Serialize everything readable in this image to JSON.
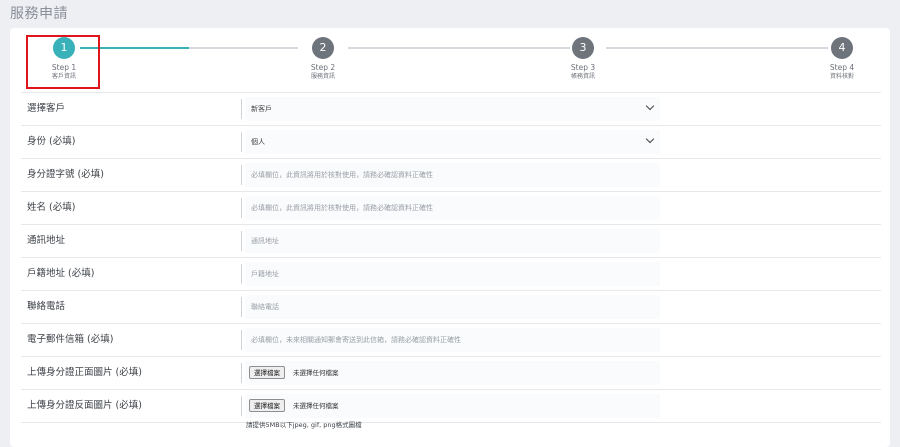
{
  "page_title": "服務申請",
  "stepper": {
    "steps": [
      {
        "number": "1",
        "label": "Step 1",
        "sub": "客戶資訊",
        "active": true
      },
      {
        "number": "2",
        "label": "Step 2",
        "sub": "服務資訊",
        "active": false
      },
      {
        "number": "3",
        "label": "Step 3",
        "sub": "帳務資訊",
        "active": false
      },
      {
        "number": "4",
        "label": "Step 4",
        "sub": "資料核對",
        "active": false
      }
    ],
    "progress_first_segment": 0.5,
    "colors": {
      "active": "#38b2b8",
      "inactive": "#6e747c",
      "highlight": "#e0141b"
    }
  },
  "form": {
    "customer": {
      "label": "選擇客戶",
      "value": "新客戶"
    },
    "identity": {
      "label": "身份 (必填)",
      "value": "個人"
    },
    "id_number": {
      "label": "身分證字號 (必填)",
      "placeholder": "必填欄位，此資訊將用於核對使用，請務必確認資料正確性"
    },
    "name": {
      "label": "姓名 (必填)",
      "placeholder": "必填欄位，此資訊將用於核對使用，請務必確認資料正確性"
    },
    "mail_address": {
      "label": "通訊地址",
      "placeholder": "通訊地址"
    },
    "household_address": {
      "label": "戶籍地址 (必填)",
      "placeholder": "戶籍地址"
    },
    "phone": {
      "label": "聯絡電話",
      "placeholder": "聯絡電話"
    },
    "email": {
      "label": "電子郵件信箱 (必填)",
      "placeholder": "必填欄位，未來相關通知郵會寄送到此信箱，請務必確認資料正確性"
    },
    "id_front": {
      "label": "上傳身分證正面圖片 (必填)",
      "button": "選擇檔案",
      "status": "未選擇任何檔案"
    },
    "id_back": {
      "label": "上傳身分證反面圖片 (必填)",
      "button": "選擇檔案",
      "status": "未選擇任何檔案"
    },
    "upload_hint": "請提供5MB以下jpeg, gif, png格式圖檔"
  }
}
